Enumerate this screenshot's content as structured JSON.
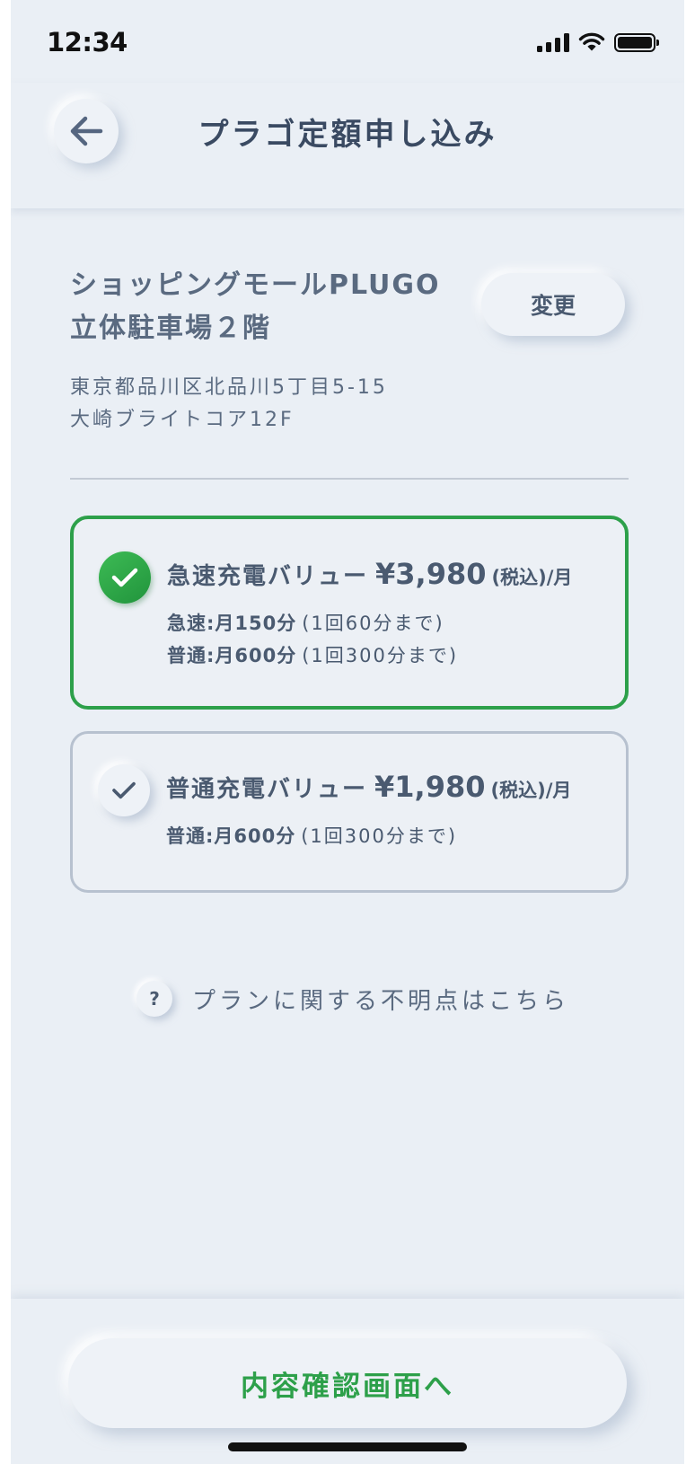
{
  "status_bar": {
    "time": "12:34"
  },
  "header": {
    "title": "プラゴ定額申し込み"
  },
  "location": {
    "name_line1": "ショッピングモールPLUGO",
    "name_line2": "立体駐車場２階",
    "address_line1": "東京都品川区北品川5丁目5-15",
    "address_line2": "大崎ブライトコア12F",
    "change_label": "変更"
  },
  "plans": [
    {
      "name": "急速充電バリュー",
      "price": "¥3,980",
      "unit": "(税込)/月",
      "selected": true,
      "details": [
        {
          "label": "急速:月150分",
          "note": "(1回60分まで)"
        },
        {
          "label": "普通:月600分",
          "note": "(1回300分まで)"
        }
      ]
    },
    {
      "name": "普通充電バリュー",
      "price": "¥1,980",
      "unit": "(税込)/月",
      "selected": false,
      "details": [
        {
          "label": "普通:月600分",
          "note": "(1回300分まで)"
        }
      ]
    }
  ],
  "help": {
    "icon_text": "?",
    "text": "プランに関する不明点はこちら"
  },
  "footer": {
    "confirm_label": "内容確認画面へ"
  },
  "colors": {
    "accent": "#2da04a",
    "background": "#eaeff5",
    "text": "#4a5a70"
  },
  "icons": {
    "back": "arrow-left-icon",
    "selected": "check-icon",
    "help": "question-icon"
  }
}
